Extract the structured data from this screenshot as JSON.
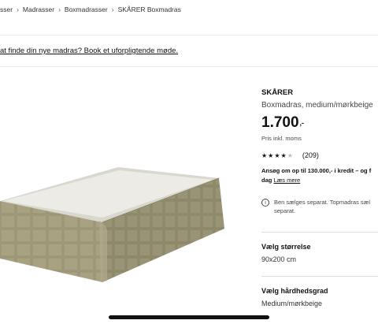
{
  "breadcrumb": {
    "items": [
      "sser",
      "Madrasser",
      "Boxmadrasser",
      "SKÅRER Boxmadras"
    ]
  },
  "banner": {
    "text": "at finde din nye madras? Book et uforpligtende møde."
  },
  "product": {
    "name": "SKÅRER",
    "description": "Boxmadras, medium/mørkbeige",
    "price": "1.700",
    "price_suffix": ",-",
    "vat_note": "Pris inkl. moms",
    "rating": 4,
    "rating_max": 5,
    "review_count": "(209)",
    "loan_text_line1": "Ansøg om op til 130.000,- i kredit – og f",
    "loan_text_line2": "dag",
    "loan_link": "Læs mere",
    "info_note_line1": "Ben sælges separat. Topmadras sæl",
    "info_note_line2": "separat."
  },
  "options": {
    "size_title": "Vælg størrelse",
    "size_value": "90x200 cm",
    "firmness_title": "Vælg hårdhedsgrad",
    "firmness_value": "Medium/mørkbeige"
  },
  "icons": {
    "info": "info-icon",
    "chevron": "chevron-right-icon",
    "star": "star-icon"
  }
}
